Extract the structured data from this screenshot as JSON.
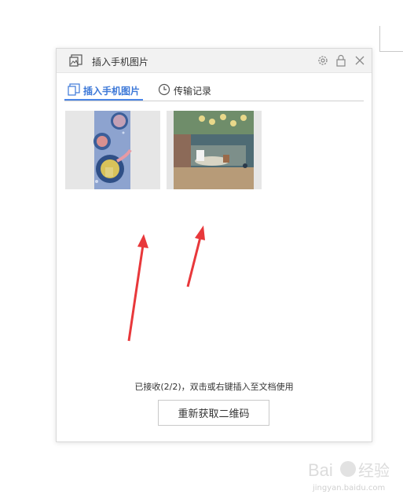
{
  "dialog": {
    "title": "插入手机图片",
    "title_icon": "image-insert-icon",
    "controls": [
      "gear-icon",
      "lock-icon",
      "close-icon"
    ]
  },
  "tabs": [
    {
      "label": "插入手机图片",
      "icon": "image-insert-icon",
      "active": true
    },
    {
      "label": "传输记录",
      "icon": "clock-icon",
      "active": false
    }
  ],
  "thumbnails": [
    {
      "name": "cartoon-bubbles-image"
    },
    {
      "name": "garden-tea-party-image"
    }
  ],
  "status_text": "已接收(2/2)，双击或右键插入至文档使用",
  "button_label": "重新获取二维码",
  "colors": {
    "accent": "#4a86e8",
    "arrow": "#e8383b"
  },
  "watermark": {
    "brand": "Bai",
    "brand_cn": "经验",
    "url": "jingyan.baidu.com"
  }
}
